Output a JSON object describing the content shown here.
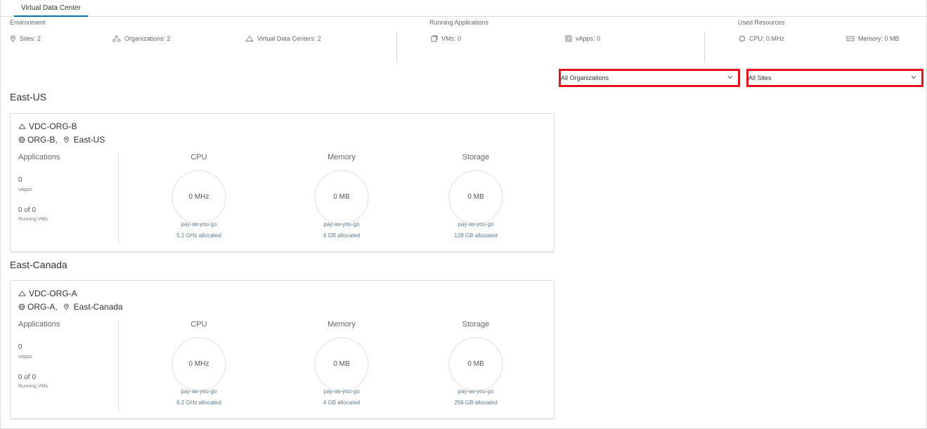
{
  "tabs": [
    {
      "label": "Virtual Data Center"
    }
  ],
  "summary": {
    "environment": {
      "title": "Environment",
      "sites": "Sites: 2",
      "organizations": "Organizations: 2",
      "vdcs": "Virtual Data Centers: 2"
    },
    "running": {
      "title": "Running Applications",
      "vms": "VMs: 0",
      "vapps": "vApps: 0"
    },
    "used": {
      "title": "Used Resources",
      "cpu": "CPU: 0 MHz",
      "memory": "Memory: 0 MB"
    }
  },
  "filters": {
    "organizations": "All Organizations",
    "sites": "All Sites"
  },
  "regions": [
    {
      "name": "East-US",
      "card": {
        "vdc": "VDC-ORG-B",
        "org": "ORG-B,",
        "site": "East-US",
        "applications": {
          "label": "Applications",
          "vapps_value": "0",
          "vapps_label": "vApps",
          "vms_value": "0 of 0",
          "vms_label": "Running VMs"
        },
        "cpu": {
          "label": "CPU",
          "value": "0 MHz",
          "model": "pay-as-you-go",
          "allocated": "5.2 GHz allocated"
        },
        "memory": {
          "label": "Memory",
          "value": "0 MB",
          "model": "pay-as-you-go",
          "allocated": "4 GB allocated"
        },
        "storage": {
          "label": "Storage",
          "value": "0 MB",
          "model": "pay-as-you-go",
          "allocated": "128 GB allocated"
        }
      }
    },
    {
      "name": "East-Canada",
      "card": {
        "vdc": "VDC-ORG-A",
        "org": "ORG-A,",
        "site": "East-Canada",
        "applications": {
          "label": "Applications",
          "vapps_value": "0",
          "vapps_label": "vApps",
          "vms_value": "0 of 0",
          "vms_label": "Running VMs"
        },
        "cpu": {
          "label": "CPU",
          "value": "0 MHz",
          "model": "pay-as-you-go",
          "allocated": "6.2 GHz allocated"
        },
        "memory": {
          "label": "Memory",
          "value": "0 MB",
          "model": "pay-as-you-go",
          "allocated": "4 GB allocated"
        },
        "storage": {
          "label": "Storage",
          "value": "0 MB",
          "model": "pay-as-you-go",
          "allocated": "256 GB allocated"
        }
      }
    }
  ],
  "colors": {
    "accent": "#0072a3",
    "highlight": "#e3121c",
    "ring": "#e8e8e8"
  }
}
